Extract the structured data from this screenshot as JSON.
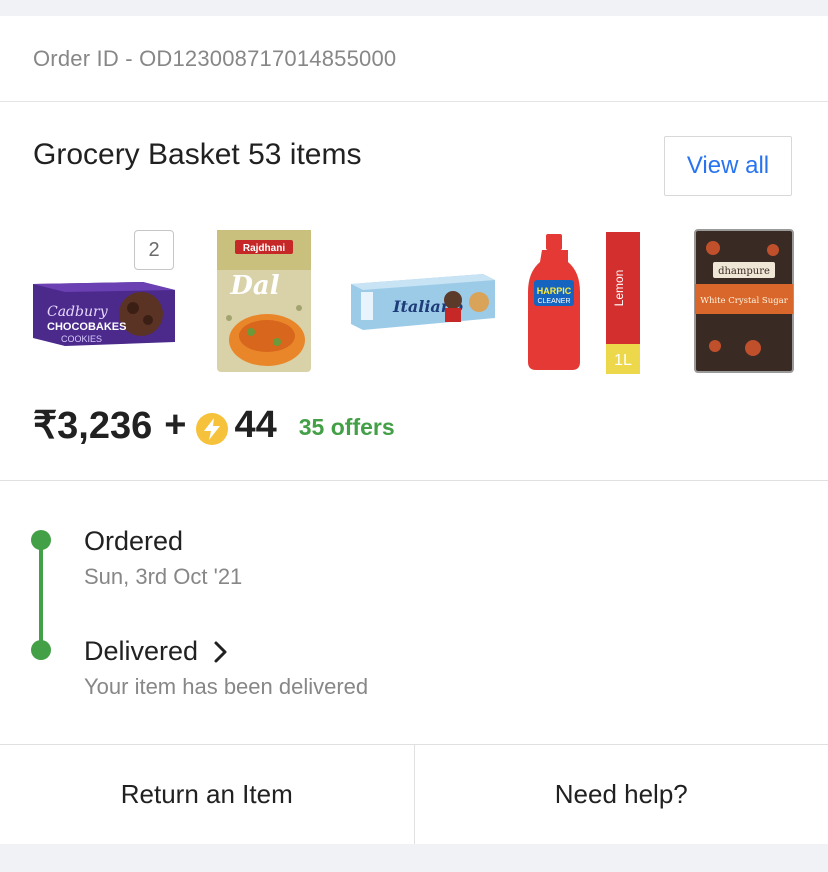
{
  "order": {
    "id_text": "Order ID - OD123008717014855000"
  },
  "basket": {
    "title": "Grocery Basket 53 items",
    "view_all_label": "View all",
    "first_item_qty": "2",
    "products": [
      {
        "name": "Cadbury Chocobakes Cookies",
        "brand": "Cadbury",
        "label": "CHOCOBAKES",
        "sublabel": "COOKIES"
      },
      {
        "name": "Rajdhani Dal",
        "brand": "Rajdhani",
        "label": "Dal"
      },
      {
        "name": "Italiano Biscuits",
        "label": "Italiano"
      },
      {
        "name": "Harpic Bathroom Cleaner Lemon 1L",
        "brand": "HARPIC",
        "label": "CLEANER",
        "variant": "Lemon",
        "size": "1L"
      },
      {
        "name": "Dhampure White Crystal Sugar",
        "brand": "dhampure",
        "label": "White Crystal Sugar"
      }
    ]
  },
  "price": {
    "amount": "₹3,236",
    "plus": "+",
    "coins": "44",
    "offers": "35 offers"
  },
  "tracking": {
    "steps": [
      {
        "label": "Ordered",
        "sub": "Sun, 3rd Oct '21"
      },
      {
        "label": "Delivered",
        "sub": "Your item has been delivered"
      }
    ]
  },
  "actions": {
    "return_label": "Return an Item",
    "help_label": "Need help?"
  },
  "colors": {
    "accent_blue": "#2874f0",
    "success_green": "#43a047",
    "coin_yellow": "#f7c23b"
  }
}
